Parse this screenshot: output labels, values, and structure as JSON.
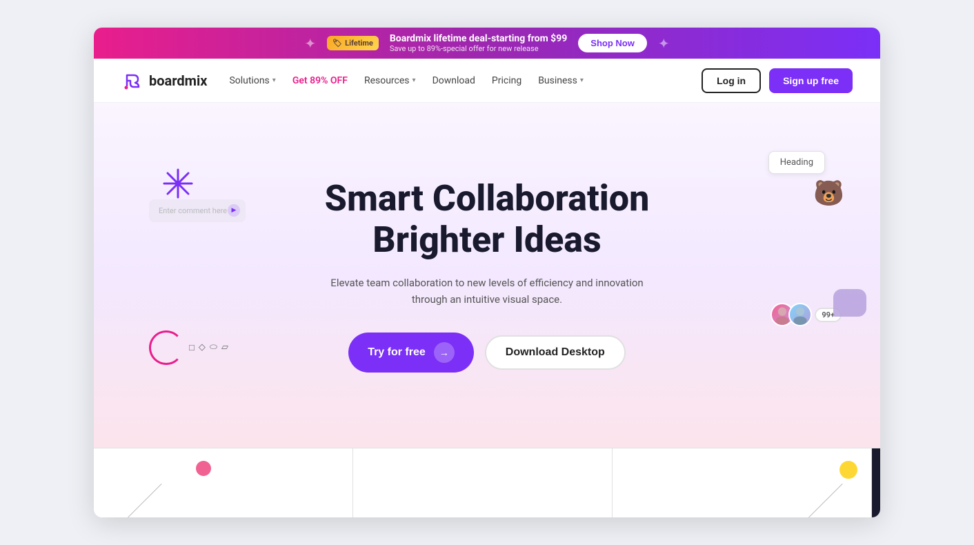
{
  "promo": {
    "badge_label": "Lifetime",
    "title": "Boardmix lifetime deal-starting from $99",
    "subtitle": "Save up to 89%-special offer for new release",
    "btn_label": "Shop Now"
  },
  "nav": {
    "logo_text": "boardmix",
    "items": [
      {
        "label": "Solutions",
        "has_dropdown": true
      },
      {
        "label": "Get 89% OFF",
        "is_promo": true,
        "has_dropdown": false
      },
      {
        "label": "Resources",
        "has_dropdown": true
      },
      {
        "label": "Download",
        "has_dropdown": false
      },
      {
        "label": "Pricing",
        "has_dropdown": false
      },
      {
        "label": "Business",
        "has_dropdown": true
      }
    ],
    "login_label": "Log in",
    "signup_label": "Sign up free"
  },
  "hero": {
    "title_line1": "Smart Collaboration",
    "title_line2": "Brighter Ideas",
    "subtitle": "Elevate team collaboration to new levels of efficiency and innovation through an intuitive visual space.",
    "btn_try_label": "Try for free",
    "btn_download_label": "Download Desktop"
  },
  "deco": {
    "comment_placeholder": "Enter comment here",
    "heading_card_text": "Heading",
    "avatar_count": "99+"
  }
}
